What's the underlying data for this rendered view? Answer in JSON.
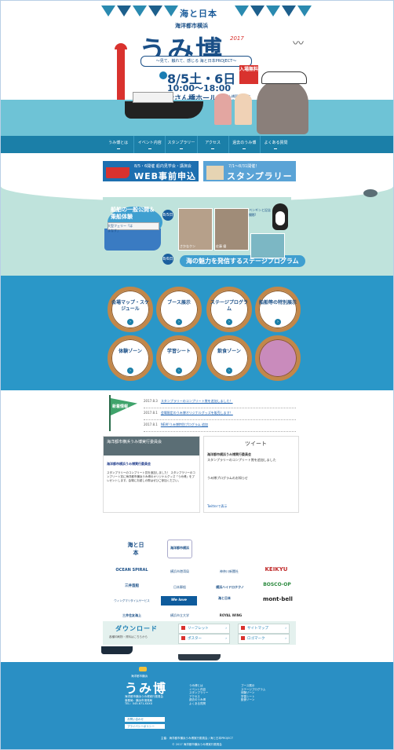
{
  "header": {
    "logo_top": "海と日本",
    "subtitle": "海洋都市横浜",
    "title": "うみ博",
    "year": "2017",
    "tagline": "〜見て、触れて、感じる 海と日本PROJECT〜",
    "free_badge": "入場無料",
    "date": "8/5土・6日",
    "time": "10:00〜18:00",
    "venue": "大さん橋ホール",
    "venue_note": "大さん橋国際客船ターミナル内"
  },
  "nav": {
    "items": [
      {
        "label": "うみ博とは"
      },
      {
        "label": "イベント内容"
      },
      {
        "label": "スタンプラリー"
      },
      {
        "label": "アクセス"
      },
      {
        "label": "過去のうみ博"
      },
      {
        "label": "よくある質問"
      }
    ]
  },
  "banners": {
    "web": {
      "small": "8/5・6開催 船内見学会・講演会",
      "big": "WEB事前申込み"
    },
    "stamp": {
      "small": "7/1〜8/31開催！",
      "big": "スタンプラリー"
    }
  },
  "special": {
    "ship_tour": "船舶の一般公開＆乗船体験",
    "date5": "8/5日",
    "date6": "8/6日",
    "stage": "海の魅力を発信するステージプログラム",
    "speaker1": "さかなクン",
    "speaker2": "佐藤 優",
    "note_left": "大型フェリー「はまなす」",
    "note_right": "ペンギンと記念撮影!"
  },
  "portholes": [
    {
      "label": "会場マップ・スケジュール"
    },
    {
      "label": "ブース展示"
    },
    {
      "label": "ステージプログラム"
    },
    {
      "label": "船舶等の特別展示"
    },
    {
      "label": "体験ゾーン"
    },
    {
      "label": "学習シート"
    },
    {
      "label": "飲食ゾーン"
    }
  ],
  "news": {
    "flag": "新着情報",
    "items": [
      {
        "date": "2017.8.3",
        "text": "スタンプラリーのコンプリート賞を追加しました！"
      },
      {
        "date": "2017.8.1",
        "text": "会場限定のうみ博オリジナルグッズを販売します！"
      },
      {
        "date": "2017.8.1",
        "text": "NEW!うみ博特別プログラム 追加"
      }
    ]
  },
  "facebook": {
    "title": "海洋都市横浜うみ博実行委員会",
    "page": "海洋都市横浜うみ博実行委員会",
    "body": "スタンプラリーのコンプリート賞を追加しました！ スタンプラリーのコンプリート賞に海洋都市横浜うみ博のオリジナルグッズ「うみ博」をプレゼントします。会場にお越しの際はぜひご参加ください。"
  },
  "twitter": {
    "head": "ツイート",
    "account": "海洋都市横浜うみ博実行委員会",
    "line1": "スタンプラリーのコンプリート賞を追加しました",
    "line2": "うみ博プログラムのお知らせ",
    "footer": "Twitterで表示"
  },
  "sponsors": [
    {
      "name": "海と日本"
    },
    {
      "name": "海洋都市横浜"
    },
    {
      "name": "OCEAN SPIRAL"
    },
    {
      "name": "横浜市港湾局"
    },
    {
      "name": "神奈川新聞社"
    },
    {
      "name": "KEIKYU"
    },
    {
      "name": "三井造船"
    },
    {
      "name": "日本郵船"
    },
    {
      "name": "横浜ハイドロテクノ"
    },
    {
      "name": "BOSCO-OP"
    },
    {
      "name": "ウィングマリタイムサービス"
    },
    {
      "name": "We love Yokohama"
    },
    {
      "name": "海と日本"
    },
    {
      "name": "mont-bell"
    },
    {
      "name": "三井住友海上"
    },
    {
      "name": "横浜市立大学"
    },
    {
      "name": "ROYAL WING"
    }
  ],
  "download": {
    "title": "ダウンロード",
    "sub": "各種印刷物・資料はこちらから",
    "buttons": [
      {
        "label": "リーフレット"
      },
      {
        "label": "サイトマップ"
      },
      {
        "label": "ポスター"
      },
      {
        "label": "ロゴマーク"
      }
    ]
  },
  "footer": {
    "logo": "うみ博",
    "logo_sub": "海洋都市横浜",
    "info": "海洋都市横浜うみ博実行委員会\n事務局：横浜市港湾局\nTEL：045-671-XXXX",
    "btn1": "お問い合わせ",
    "btn2": "プライバシーポリシー",
    "col1": "うみ博とは\nイベント内容\nスタンプラリー\nアクセス\n過去のうみ博\nよくある質問",
    "col2": "ブース展示\nステージプログラム\n体験ゾーン\n学習シート\n飲食ゾーン",
    "copy1": "主催：海洋都市横浜うみ博実行委員会 / 海と日本PROJECT",
    "copy2": "© 2017 海洋都市横浜うみ博実行委員会"
  }
}
